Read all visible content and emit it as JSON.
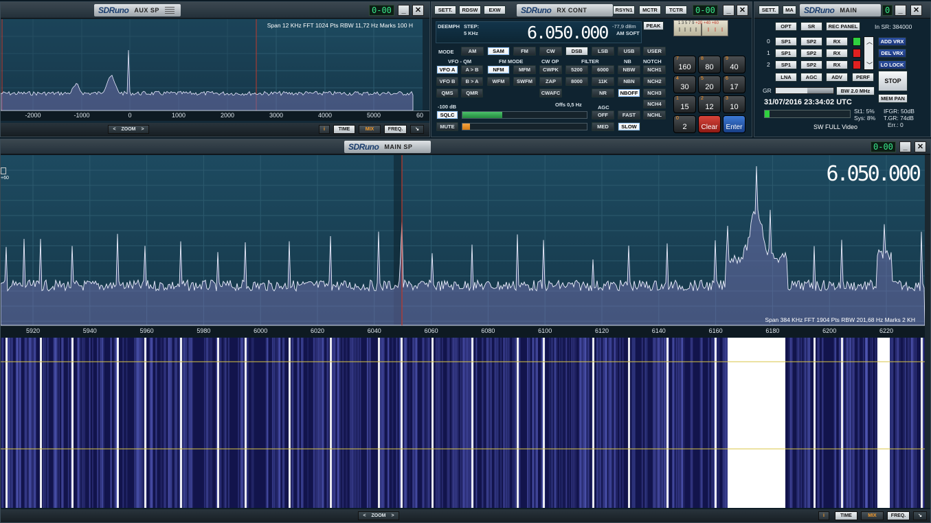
{
  "aux_sp": {
    "logo": "SDRuno",
    "title": "AUX SP",
    "clock": "0-00",
    "info": "Span 12 KHz   FFT 1024 Pts   RBW 11,72 Hz   Marks 100 H",
    "ticks": [
      "-2000",
      "-1000",
      "0",
      "1000",
      "2000",
      "3000",
      "4000",
      "5000",
      "60"
    ],
    "zoom_label": "ZOOM",
    "buttons": {
      "info": "i",
      "time": "TIME",
      "mix": "MIX",
      "freq": "FREQ.",
      "resize": "↘"
    }
  },
  "rx_control": {
    "settings": "SETT.",
    "rdsw": "RDSW",
    "exw": "EXW",
    "logo": "SDRuno",
    "title": "RX CONT",
    "rsyn": "RSYN1",
    "mctr": "MCTR",
    "tctr": "TCTR",
    "clock": "0-00",
    "deemph": "DEEMPH",
    "step_label": "STEP:",
    "step_value": "5 KHz",
    "frequency": "6.050.000",
    "level": "-77,9 dBm",
    "am_mode": "AM SOFT",
    "peak": "PEAK",
    "mode_label": "MODE",
    "modes": [
      "AM",
      "SAM",
      "FM",
      "CW",
      "DSB",
      "LSB",
      "USB",
      "USER"
    ],
    "section_labels": {
      "vfo": "VFO - QM",
      "fm_mode": "FM MODE",
      "cw_op": "CW OP",
      "filter": "FILTER",
      "nb": "NB",
      "notch": "NOTCH",
      "agc": "AGC"
    },
    "vfo": [
      "VFO A",
      "A > B",
      "VFO B",
      "B > A",
      "QMS",
      "QMR"
    ],
    "fm_modes": [
      "NFM",
      "MFM",
      "WFM",
      "SWFM"
    ],
    "cw_op": [
      "CWPK",
      "ZAP",
      "CWAFC"
    ],
    "filters": [
      "5200",
      "6000",
      "8000",
      "11K",
      "NR"
    ],
    "nb": [
      "NBW",
      "NBN",
      "NBOFF"
    ],
    "notch": [
      "NCH1",
      "NCH2",
      "NCH3",
      "NCH4",
      "NCHL"
    ],
    "agc": [
      "OFF",
      "FAST",
      "MED",
      "SLOW"
    ],
    "squelch_level": "-100 dB",
    "offset": "Offs 0,5 Hz",
    "sqlc": "SQLC",
    "mute": "MUTE",
    "squelch_fill": 0.32,
    "mute_fill": 0.06,
    "keypad": [
      {
        "top": "7",
        "main": "160"
      },
      {
        "top": "8",
        "main": "80"
      },
      {
        "top": "9",
        "main": "40"
      },
      {
        "top": "4",
        "main": "30"
      },
      {
        "top": "5",
        "main": "20"
      },
      {
        "top": "6",
        "main": "17"
      },
      {
        "top": "1",
        "main": "15"
      },
      {
        "top": "2",
        "main": "12"
      },
      {
        "top": "3",
        "main": "10"
      },
      {
        "top": "0",
        "main": "2"
      },
      {
        "top": "",
        "main": "Clear"
      },
      {
        "top": "",
        "main": "Enter"
      }
    ],
    "smeter_scale": [
      "1",
      "3",
      "5",
      "7",
      "9",
      "+20",
      "+40",
      "+60"
    ]
  },
  "main_panel": {
    "settings": "SETT.",
    "ma": "MA",
    "logo": "SDRuno",
    "title": "MAIN",
    "clock": "0",
    "opt": "OPT",
    "sr": "SR",
    "rec_panel": "REC PANEL",
    "in_sr": "In SR: 384000",
    "rows": [
      {
        "index": "0",
        "sp1": "SP1",
        "sp2": "SP2",
        "rx": "RX",
        "color": "#2fd13f"
      },
      {
        "index": "1",
        "sp1": "SP1",
        "sp2": "SP2",
        "rx": "RX",
        "color": "#e02020"
      },
      {
        "index": "2",
        "sp1": "SP1",
        "sp2": "SP2",
        "rx": "RX",
        "color": "#e02020"
      }
    ],
    "add_vrx": "ADD VRX",
    "del_vrx": "DEL VRX",
    "lo_lock": "LO LOCK",
    "lna": "LNA",
    "agc": "AGC",
    "adv": "ADV",
    "perf": "PERF",
    "stop": "STOP",
    "mem_pan": "MEM PAN",
    "gr_label": "GR",
    "bw": "BW 2.0 MHz",
    "datetime": "31/07/2016 23:34:02 UTC",
    "st1": "St1: 5%",
    "sys": "Sys: 8%",
    "ifgr": "IFGR: 50dB",
    "tgr": "T.GR: 74dB",
    "err": "Err.: 0",
    "preset": "SW FULL Video"
  },
  "main_sp": {
    "logo": "SDRuno",
    "title": "MAIN SP",
    "clock": "0-00",
    "frequency": "6.050.000",
    "left_marker": "+60",
    "info": "Span 384 KHz   FFT 1904 Pts   RBW 201,68 Hz   Marks 2 KH",
    "ticks": [
      "5920",
      "5940",
      "5960",
      "5980",
      "6000",
      "6020",
      "6040",
      "6060",
      "6080",
      "6100",
      "6120",
      "6140",
      "6160",
      "6180",
      "6200",
      "6220"
    ],
    "zoom_label": "ZOOM",
    "buttons": {
      "info": "i",
      "time": "TIME",
      "mix": "MIX",
      "freq": "FREQ.",
      "resize": "↘"
    },
    "colors": {
      "accent": "#f39a2c",
      "spectrum_fill": "#5a5f9a",
      "waterfall_bg": "#12144c"
    }
  }
}
